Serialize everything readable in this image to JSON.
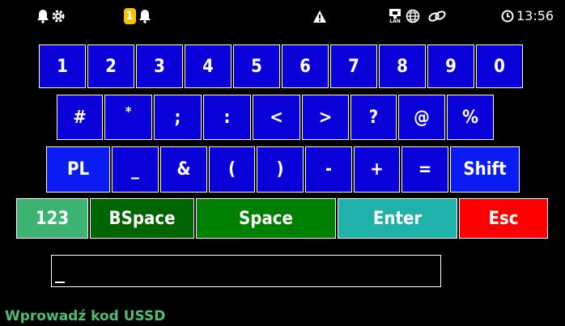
{
  "status_bar": {
    "alert_badge": "1",
    "time": "13:56",
    "lan_label": "LAN"
  },
  "keyboard": {
    "row1": [
      "1",
      "2",
      "3",
      "4",
      "5",
      "6",
      "7",
      "8",
      "9",
      "0"
    ],
    "row2": [
      "#",
      "*",
      ";",
      ":",
      "<",
      ">",
      "?",
      "@",
      "%"
    ],
    "row3": [
      "PL",
      "_",
      "&",
      "(",
      ")",
      "-",
      "+",
      "=",
      "Shift"
    ],
    "row4": {
      "num": "123",
      "backspace": "BSpace",
      "space": "Space",
      "enter": "Enter",
      "esc": "Esc"
    }
  },
  "input": {
    "value": ""
  },
  "prompt": "Wprowadź kod USSD",
  "colors": {
    "key_blue": "#0a00d8",
    "key_bright_blue": "#0a1cf2",
    "num_key": "#3cb371",
    "bspace_key": "#006400",
    "space_key": "#008000",
    "enter_key": "#20b2aa",
    "esc_key": "#ff0000",
    "badge": "#f5c400",
    "prompt_text": "#4fbf6f"
  }
}
